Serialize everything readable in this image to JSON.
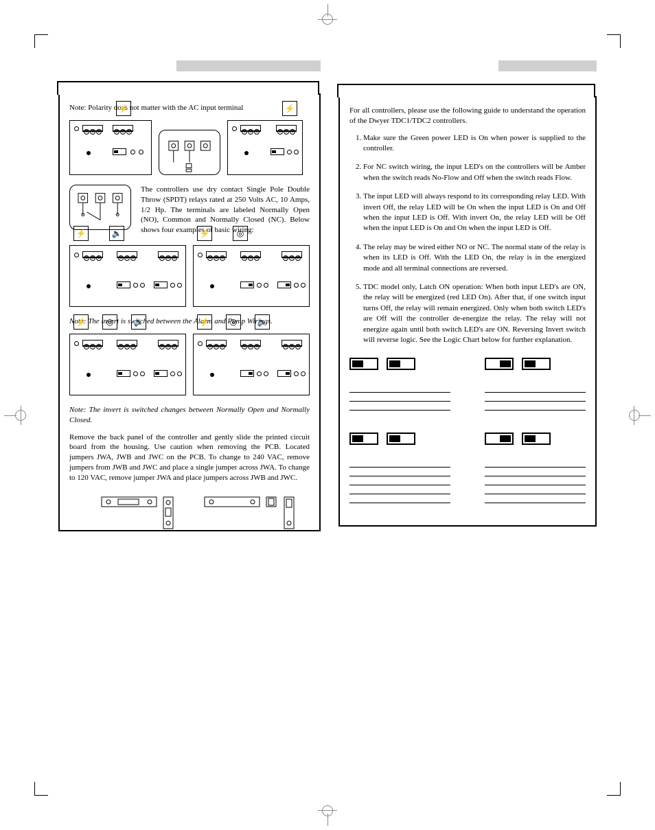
{
  "left": {
    "polarity_note": "Note: Polarity does not matter with the AC input terminal",
    "relay_desc": "The controllers use dry contact Single Pole Double Throw (SPDT) relays rated at 250 Volts AC, 10 Amps, 1/2 Hp. The terminals are labeled Normally Open (NO), Common and Normally Closed (NC). Below shows four examples of basic wiring:",
    "invert_note_1": "Note: The invert is switched between the Alarm and Pump Wirings.",
    "invert_note_2": "Note: The invert is switched changes between Normally Open and Normally Closed.",
    "jumper_para": "Remove the back panel of the controller and gently slide the printed circuit board from the housing. Use caution when removing the PCB. Located jumpers JWA, JWB and JWC on the PCB. To change to 240 VAC, remove jumpers from JWB and JWC and place a single jumper across JWA. To change to 120 VAC, remove jumper JWA and place jumpers across JWB and JWC."
  },
  "right": {
    "intro": "For all controllers, please use the following guide to understand the operation of the Dwyer TDC1/TDC2 controllers.",
    "ops": [
      "Make sure the Green power LED is On when power is supplied to the controller.",
      "For NC switch wiring, the input LED's on the controllers will be Amber when the switch reads No-Flow and Off when the switch reads Flow.",
      "The input LED will always respond to its corresponding relay LED. With invert Off, the relay LED will be On when the input LED is On and Off when the input LED is Off. With invert On, the relay LED will be Off when the input LED is On and On when the input LED is Off.",
      "The relay may be wired either NO or NC. The normal state of the relay is when its LED is Off. With the LED On, the relay is in the energized mode and all terminal connections are reversed.",
      "TDC model only, Latch ON operation: When both input LED's are ON, the relay will be energized (red LED On). After that, if one switch input turns Off, the relay will remain energized. Only when both switch LED's are Off will the controller de-energize the relay. The relay will not energize again until both switch LED's are ON. Reversing Invert switch will reverse logic. See the Logic Chart below for further explanation."
    ]
  }
}
